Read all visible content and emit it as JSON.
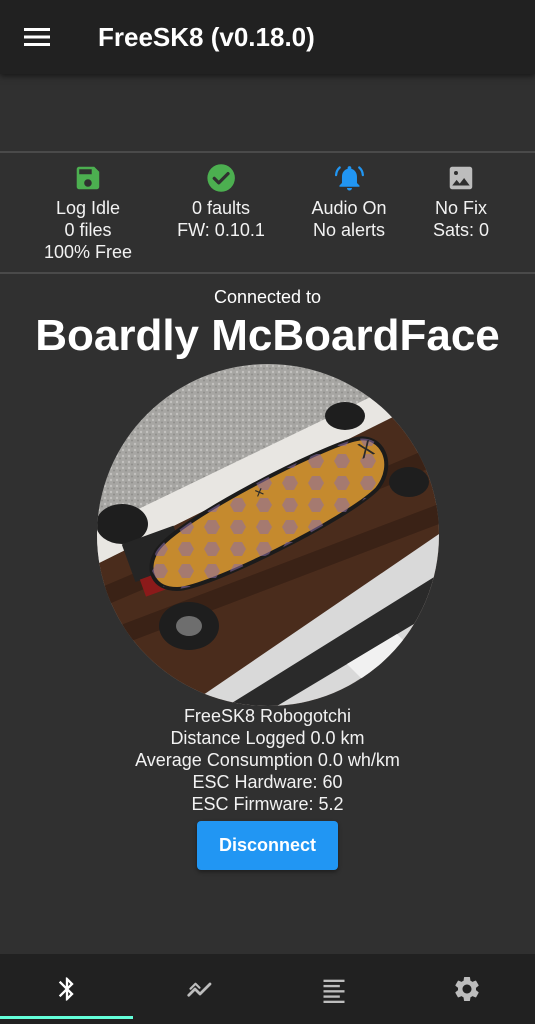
{
  "appbar": {
    "title": "FreeSK8 (v0.18.0)",
    "menu_icon": "hamburger-menu-icon"
  },
  "status": {
    "log": {
      "icon": "save-icon",
      "color": "#4caf50",
      "lines": [
        "Log Idle",
        "0 files",
        "100% Free"
      ]
    },
    "faults": {
      "icon": "check-circle-icon",
      "color": "#4caf50",
      "lines": [
        "0 faults",
        "FW: 0.10.1"
      ]
    },
    "audio": {
      "icon": "alarm-bell-icon",
      "color": "#2196f3",
      "lines": [
        "Audio On",
        "No alerts"
      ]
    },
    "gps": {
      "icon": "image-icon",
      "color": "#bdbdbd",
      "lines": [
        "No Fix",
        "Sats: 0"
      ]
    }
  },
  "connection": {
    "label": "Connected to",
    "board_name": "Boardly McBoardFace"
  },
  "board_info": {
    "device": "FreeSK8 Robogotchi",
    "distance": "Distance Logged 0.0 km",
    "consumption": "Average Consumption 0.0 wh/km",
    "esc_hardware": "ESC Hardware: 60",
    "esc_firmware": "ESC Firmware: 5.2"
  },
  "actions": {
    "disconnect_label": "Disconnect",
    "accent": "#2196f3"
  },
  "bottom_nav": {
    "tabs": [
      {
        "icon": "bluetooth-icon",
        "selected": true
      },
      {
        "icon": "realtime-chart-icon",
        "selected": false
      },
      {
        "icon": "list-icon",
        "selected": false
      },
      {
        "icon": "gear-icon",
        "selected": false
      }
    ],
    "indicator_color": "#64ffda"
  }
}
